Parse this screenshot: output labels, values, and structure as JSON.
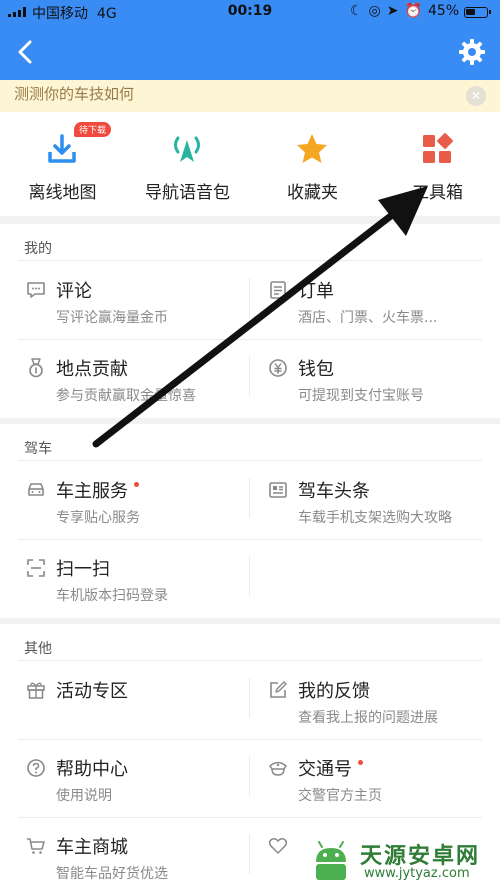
{
  "status_bar": {
    "carrier": "中国移动",
    "network": "4G",
    "time": "00:19",
    "battery": "45%"
  },
  "banner": {
    "text": "测测你的车技如何"
  },
  "shortcuts": [
    {
      "label": "离线地图",
      "badge": "待下载",
      "icon": "download-icon"
    },
    {
      "label": "导航语音包",
      "icon": "voice-package-icon"
    },
    {
      "label": "收藏夹",
      "icon": "star-icon"
    },
    {
      "label": "工具箱",
      "icon": "toolbox-icon"
    }
  ],
  "sections": {
    "mine": {
      "title": "我的",
      "items": [
        {
          "title": "评论",
          "subtitle": "写评论赢海量金币",
          "icon": "comment-icon"
        },
        {
          "title": "订单",
          "subtitle": "酒店、门票、火车票...",
          "icon": "order-icon"
        },
        {
          "title": "地点贡献",
          "subtitle": "参与贡献赢取金量惊喜",
          "icon": "medal-icon"
        },
        {
          "title": "钱包",
          "subtitle": "可提现到支付宝账号",
          "icon": "wallet-icon"
        }
      ]
    },
    "driving": {
      "title": "驾车",
      "items": [
        {
          "title": "车主服务",
          "subtitle": "专享贴心服务",
          "icon": "car-icon",
          "dot": true
        },
        {
          "title": "驾车头条",
          "subtitle": "车载手机支架选购大攻略",
          "icon": "news-icon"
        },
        {
          "title": "扫一扫",
          "subtitle": "车机版本扫码登录",
          "icon": "scan-icon"
        }
      ]
    },
    "other": {
      "title": "其他",
      "items": [
        {
          "title": "活动专区",
          "subtitle": "",
          "icon": "gift-icon"
        },
        {
          "title": "我的反馈",
          "subtitle": "查看我上报的问题进展",
          "icon": "feedback-icon"
        },
        {
          "title": "帮助中心",
          "subtitle": "使用说明",
          "icon": "help-icon"
        },
        {
          "title": "交通号",
          "subtitle": "交警官方主页",
          "icon": "police-icon",
          "dot": true
        },
        {
          "title": "车主商城",
          "subtitle": "智能车品好货优选",
          "icon": "cart-icon"
        },
        {
          "title": "",
          "subtitle": "",
          "icon": "heart-icon"
        }
      ]
    }
  },
  "watermark": {
    "title": "天源安卓网",
    "url": "www.jytyaz.com"
  },
  "colors": {
    "header": "#3a8cf5",
    "banner_bg": "#fdf5d4",
    "badge": "#f04a3e",
    "star": "#f5a623",
    "teal": "#28b5a0",
    "red_tiles": "#e85c4a"
  }
}
